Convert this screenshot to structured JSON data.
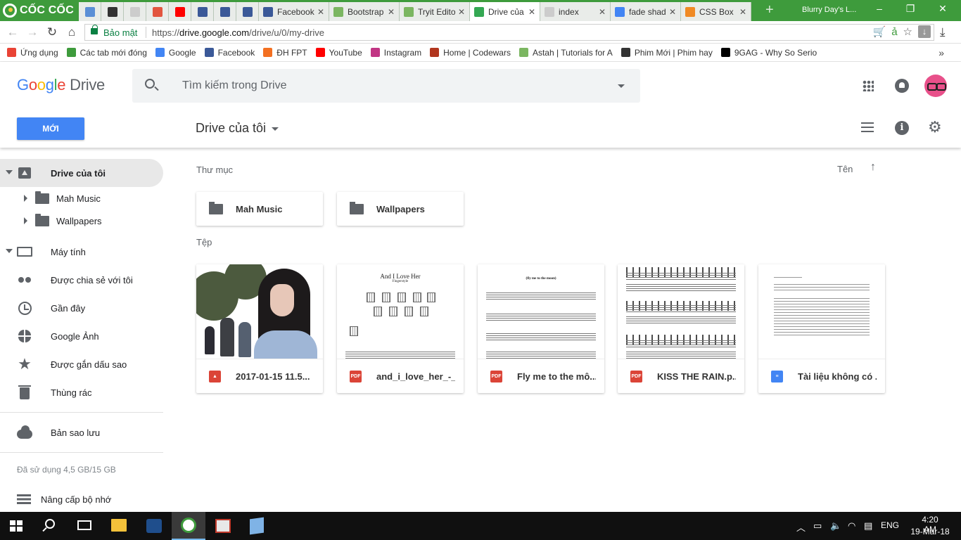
{
  "browser": {
    "brand": "CỐC CỐC",
    "window_title": "Blurry Day's L...",
    "tabs": [
      {
        "label": "",
        "icon": "weather-icon",
        "color": "#5b8fd6"
      },
      {
        "label": "",
        "icon": "film-icon",
        "color": "#333333"
      },
      {
        "label": "",
        "icon": "document-icon",
        "color": "#cccccc"
      },
      {
        "label": "",
        "icon": "78-icon",
        "color": "#e2553f"
      },
      {
        "label": "",
        "icon": "youtube-icon",
        "color": "#ff0000"
      },
      {
        "label": "",
        "icon": "facebook-icon",
        "color": "#3b5998"
      },
      {
        "label": "",
        "icon": "facebook-icon",
        "color": "#3b5998"
      },
      {
        "label": "",
        "icon": "facebook-icon",
        "color": "#3b5998"
      },
      {
        "label": "Facebook",
        "icon": "facebook-icon",
        "color": "#3b5998"
      },
      {
        "label": "Bootstrap",
        "icon": "wave-icon",
        "color": "#7bb661"
      },
      {
        "label": "Tryit Edito",
        "icon": "wave-icon",
        "color": "#7bb661"
      },
      {
        "label": "Drive của",
        "icon": "drive-icon",
        "color": "#34a853"
      },
      {
        "label": "index",
        "icon": "document-icon",
        "color": "#cccccc"
      },
      {
        "label": "fade shad",
        "icon": "google-icon",
        "color": "#4285f4"
      },
      {
        "label": "CSS Box",
        "icon": "asterisk-icon",
        "color": "#f08a24"
      }
    ],
    "secure_label": "Bảo mật",
    "url_scheme": "https://",
    "url_host": "drive.google.com",
    "url_path": "/drive/u/0/my-drive",
    "bookmarks": [
      {
        "label": "Ứng dụng",
        "color": "#e94335"
      },
      {
        "label": "Các tab mới đóng",
        "color": "#3e9b3c"
      },
      {
        "label": "Google",
        "color": "#4285f4"
      },
      {
        "label": "Facebook",
        "color": "#3b5998"
      },
      {
        "label": "ĐH FPT",
        "color": "#f37021"
      },
      {
        "label": "YouTube",
        "color": "#ff0000"
      },
      {
        "label": "Instagram",
        "color": "#c13584"
      },
      {
        "label": "Home | Codewars",
        "color": "#b1361e"
      },
      {
        "label": "Astah | Tutorials for A",
        "color": "#7bb661"
      },
      {
        "label": "Phim Mới | Phim hay",
        "color": "#333333"
      },
      {
        "label": "9GAG - Why So Serio",
        "color": "#000000"
      }
    ]
  },
  "drive": {
    "logo_google": "Google",
    "logo_drive": "Drive",
    "search_placeholder": "Tìm kiếm trong Drive",
    "new_button": "MỚI",
    "breadcrumb": "Drive của tôi",
    "sidebar": {
      "my_drive": "Drive của tôi",
      "subfolders": [
        "Mah Music",
        "Wallpapers"
      ],
      "computers": "Máy tính",
      "shared": "Được chia sẻ với tôi",
      "recent": "Gần đây",
      "photos": "Google Ảnh",
      "starred": "Được gắn dấu sao",
      "trash": "Thùng rác",
      "backups": "Bản sao lưu",
      "storage_used": "Đã sử dụng 4,5 GB/15 GB",
      "upgrade": "Nâng cấp bộ nhớ"
    },
    "folders_heading": "Thư mục",
    "sort_label": "Tên",
    "folders": [
      "Mah Music",
      "Wallpapers"
    ],
    "files_heading": "Tệp",
    "files": [
      {
        "name": "2017-01-15 11.5...",
        "type": "image",
        "color": "#db4437",
        "badge": ""
      },
      {
        "name": "and_i_love_her_-_...",
        "type": "pdf",
        "color": "#db4437",
        "badge": "PDF",
        "thumb_title": "And I Love Her",
        "thumb_sub": "Fingerstyle"
      },
      {
        "name": "Fly me to the mô...",
        "type": "pdf",
        "color": "#db4437",
        "badge": "PDF",
        "thumb_title": "(fly me to the moon)"
      },
      {
        "name": "KISS THE RAIN.p...",
        "type": "pdf",
        "color": "#db4437",
        "badge": "PDF"
      },
      {
        "name": "Tài liệu không có ...",
        "type": "doc",
        "color": "#4285f4",
        "badge": ""
      }
    ]
  },
  "taskbar": {
    "lang": "ENG",
    "time": "4:20 AM",
    "date": "19-Mar-18"
  }
}
